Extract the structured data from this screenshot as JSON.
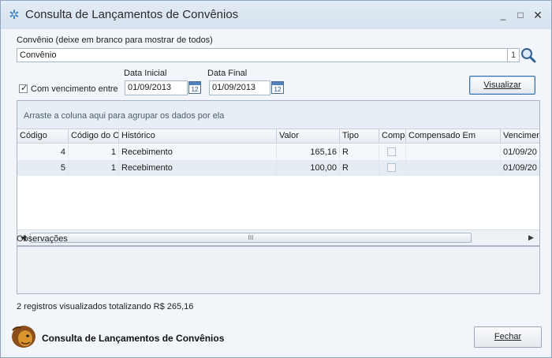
{
  "window": {
    "title": "Consulta de Lançamentos de Convênios",
    "icon": "gear-cog-icon",
    "controls": {
      "minimize": "_",
      "maximize": "□",
      "close": "✕"
    }
  },
  "filter": {
    "convenio_label": "Convênio (deixe em branco para mostrar de todos)",
    "convenio_value": "Convênio",
    "convenio_count": "1",
    "vencimento_checked": true,
    "vencimento_label": "Com vencimento entre",
    "data_inicial_label": "Data Inicial",
    "data_inicial_value": "01/09/2013",
    "data_final_label": "Data Final",
    "data_final_value": "01/09/2013",
    "calendar_day": "12",
    "visualizar_label": "Visualizar"
  },
  "grid": {
    "group_hint": "Arraste a coluna aqui para agrupar os dados por ela",
    "columns": [
      "Código",
      "Código do Co",
      "Histórico",
      "Valor",
      "Tipo",
      "Compe",
      "Compensado Em",
      "Vencimen"
    ],
    "rows": [
      {
        "codigo": "4",
        "codigo_convenio": "1",
        "historico": "Recebimento",
        "valor": "165,16",
        "tipo": "R",
        "compensado": false,
        "compensado_em": "",
        "vencimento": "01/09/20"
      },
      {
        "codigo": "5",
        "codigo_convenio": "1",
        "historico": "Recebimento",
        "valor": "100,00",
        "tipo": "R",
        "compensado": false,
        "compensado_em": "",
        "vencimento": "01/09/20"
      }
    ],
    "scroll_grip": "III"
  },
  "observacoes": {
    "label": "Observações",
    "value": ""
  },
  "status": {
    "summary": "2 registros visualizados totalizando R$ 265,16"
  },
  "footer": {
    "title": "Consulta de Lançamentos de Convênios",
    "logo": "lion-mascot-icon",
    "fechar_label": "Fechar"
  },
  "colors": {
    "accent": "#3a7fc8",
    "title_bar": "#dce6f1",
    "grid_header": "#eef2f7"
  }
}
